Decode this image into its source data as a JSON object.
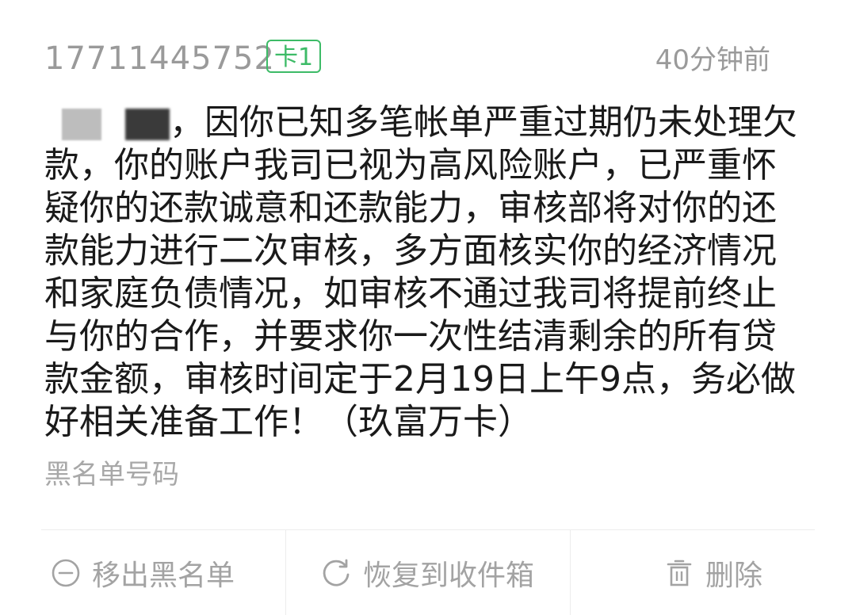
{
  "message": {
    "sender": "17711445752",
    "sim_badge": "卡1",
    "timestamp": "40分钟前",
    "salutation_suffix": "，",
    "body": "因你已知多笔帐单严重过期仍未处理欠款，你的账户我司已视为高风险账户，已严重怀疑你的还款诚意和还款能力，审核部将对你的还款能力进行二次审核，多方面核实你的经济情况和家庭负债情况，如审核不通过我司将提前终止与你的合作，并要求你一次性结清剩余的所有贷款金额，审核时间定于2月19日上午9点，务必做好相关准备工作！（玖富万卡）",
    "blacklist_label": "黑名单号码"
  },
  "actions": {
    "remove_blacklist": {
      "label": "移出黑名单",
      "icon": "minus-circle-icon"
    },
    "restore_inbox": {
      "label": "恢复到收件箱",
      "icon": "restore-icon"
    },
    "delete": {
      "label": "删除",
      "icon": "trash-icon"
    }
  },
  "colors": {
    "accent_green": "#3dbb67",
    "secondary_text": "#9a9a9a",
    "body_text": "#1a1a1a"
  }
}
